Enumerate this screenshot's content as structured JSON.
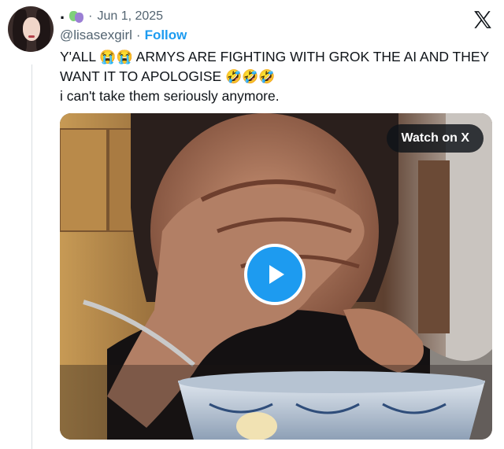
{
  "tweet": {
    "display_name": ".",
    "date": "Jun 1, 2025",
    "handle": "@lisasexgirl",
    "follow_label": "Follow",
    "text_line1_a": "Y'ALL",
    "text_line1_emoji": "😭😭",
    "text_line1_b": "ARMYS ARE FIGHTING WITH GROK THE AI AND THEY",
    "text_line2_a": "WANT IT TO APOLOGISE",
    "text_line2_emoji": "🤣🤣🤣",
    "text_line3": "i can't take them seriously anymore."
  },
  "media": {
    "watch_label": "Watch on X"
  },
  "icons": {
    "name_badge": "theater-masks-icon",
    "brand": "x-logo-icon",
    "play": "play-icon"
  },
  "colors": {
    "accent": "#1d9bf0",
    "text": "#0f1419",
    "secondary": "#536471"
  }
}
